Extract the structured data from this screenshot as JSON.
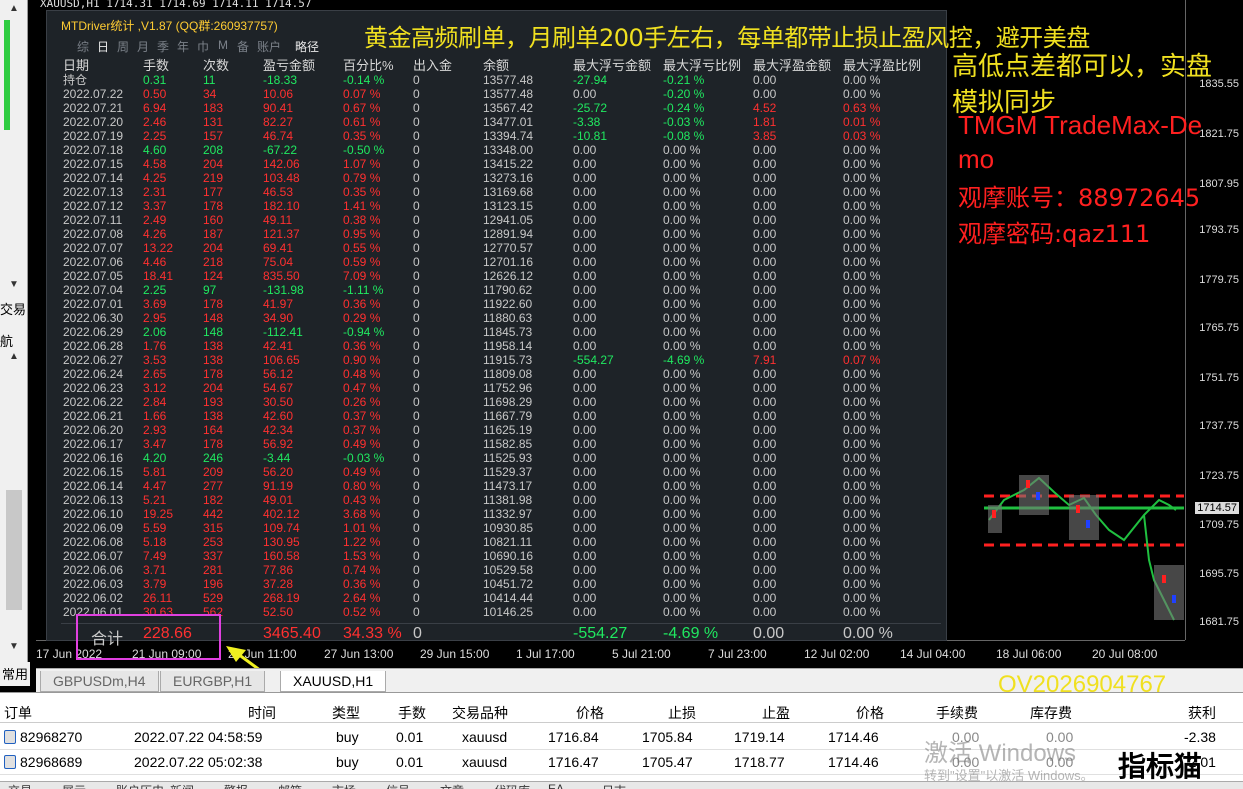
{
  "chart_header": "XAUUSD,H1  1714.31 1714.69 1714.11 1714.57",
  "panel": {
    "title": "MTDriver统计 ,V1.87 (QQ群:260937757)",
    "tabs": [
      "综",
      "日",
      "周",
      "月",
      "季",
      "年",
      "巾",
      "M",
      "备",
      "账户",
      "略径"
    ],
    "active_tab": "日",
    "headers": [
      "日期",
      "手数",
      "次数",
      "盈亏金额",
      "百分比%",
      "出入金",
      "余额",
      "最大浮亏金额",
      "最大浮亏比例",
      "最大浮盈金额",
      "最大浮盈比例"
    ],
    "rows": [
      [
        "持仓",
        "0.31",
        "11",
        "-18.33",
        "-0.14 %",
        "0",
        "13577.48",
        "-27.94",
        "-0.21 %",
        "0.00",
        "0.00 %"
      ],
      [
        "2022.07.22",
        "0.50",
        "34",
        "10.06",
        "0.07 %",
        "0",
        "13577.48",
        "0.00",
        "-0.20 %",
        "0.00",
        "0.00 %"
      ],
      [
        "2022.07.21",
        "6.94",
        "183",
        "90.41",
        "0.67 %",
        "0",
        "13567.42",
        "-25.72",
        "-0.24 %",
        "4.52",
        "0.63 %"
      ],
      [
        "2022.07.20",
        "2.46",
        "131",
        "82.27",
        "0.61 %",
        "0",
        "13477.01",
        "-3.38",
        "-0.03 %",
        "1.81",
        "0.01 %"
      ],
      [
        "2022.07.19",
        "2.25",
        "157",
        "46.74",
        "0.35 %",
        "0",
        "13394.74",
        "-10.81",
        "-0.08 %",
        "3.85",
        "0.03 %"
      ],
      [
        "2022.07.18",
        "4.60",
        "208",
        "-67.22",
        "-0.50 %",
        "0",
        "13348.00",
        "0.00",
        "0.00 %",
        "0.00",
        "0.00 %"
      ],
      [
        "2022.07.15",
        "4.58",
        "204",
        "142.06",
        "1.07 %",
        "0",
        "13415.22",
        "0.00",
        "0.00 %",
        "0.00",
        "0.00 %"
      ],
      [
        "2022.07.14",
        "4.25",
        "219",
        "103.48",
        "0.79 %",
        "0",
        "13273.16",
        "0.00",
        "0.00 %",
        "0.00",
        "0.00 %"
      ],
      [
        "2022.07.13",
        "2.31",
        "177",
        "46.53",
        "0.35 %",
        "0",
        "13169.68",
        "0.00",
        "0.00 %",
        "0.00",
        "0.00 %"
      ],
      [
        "2022.07.12",
        "3.37",
        "178",
        "182.10",
        "1.41 %",
        "0",
        "13123.15",
        "0.00",
        "0.00 %",
        "0.00",
        "0.00 %"
      ],
      [
        "2022.07.11",
        "2.49",
        "160",
        "49.11",
        "0.38 %",
        "0",
        "12941.05",
        "0.00",
        "0.00 %",
        "0.00",
        "0.00 %"
      ],
      [
        "2022.07.08",
        "4.26",
        "187",
        "121.37",
        "0.95 %",
        "0",
        "12891.94",
        "0.00",
        "0.00 %",
        "0.00",
        "0.00 %"
      ],
      [
        "2022.07.07",
        "13.22",
        "204",
        "69.41",
        "0.55 %",
        "0",
        "12770.57",
        "0.00",
        "0.00 %",
        "0.00",
        "0.00 %"
      ],
      [
        "2022.07.06",
        "4.46",
        "218",
        "75.04",
        "0.59 %",
        "0",
        "12701.16",
        "0.00",
        "0.00 %",
        "0.00",
        "0.00 %"
      ],
      [
        "2022.07.05",
        "18.41",
        "124",
        "835.50",
        "7.09 %",
        "0",
        "12626.12",
        "0.00",
        "0.00 %",
        "0.00",
        "0.00 %"
      ],
      [
        "2022.07.04",
        "2.25",
        "97",
        "-131.98",
        "-1.11 %",
        "0",
        "11790.62",
        "0.00",
        "0.00 %",
        "0.00",
        "0.00 %"
      ],
      [
        "2022.07.01",
        "3.69",
        "178",
        "41.97",
        "0.36 %",
        "0",
        "11922.60",
        "0.00",
        "0.00 %",
        "0.00",
        "0.00 %"
      ],
      [
        "2022.06.30",
        "2.95",
        "148",
        "34.90",
        "0.29 %",
        "0",
        "11880.63",
        "0.00",
        "0.00 %",
        "0.00",
        "0.00 %"
      ],
      [
        "2022.06.29",
        "2.06",
        "148",
        "-112.41",
        "-0.94 %",
        "0",
        "11845.73",
        "0.00",
        "0.00 %",
        "0.00",
        "0.00 %"
      ],
      [
        "2022.06.28",
        "1.76",
        "138",
        "42.41",
        "0.36 %",
        "0",
        "11958.14",
        "0.00",
        "0.00 %",
        "0.00",
        "0.00 %"
      ],
      [
        "2022.06.27",
        "3.53",
        "138",
        "106.65",
        "0.90 %",
        "0",
        "11915.73",
        "-554.27",
        "-4.69 %",
        "7.91",
        "0.07 %"
      ],
      [
        "2022.06.24",
        "2.65",
        "178",
        "56.12",
        "0.48 %",
        "0",
        "11809.08",
        "0.00",
        "0.00 %",
        "0.00",
        "0.00 %"
      ],
      [
        "2022.06.23",
        "3.12",
        "204",
        "54.67",
        "0.47 %",
        "0",
        "11752.96",
        "0.00",
        "0.00 %",
        "0.00",
        "0.00 %"
      ],
      [
        "2022.06.22",
        "2.84",
        "193",
        "30.50",
        "0.26 %",
        "0",
        "11698.29",
        "0.00",
        "0.00 %",
        "0.00",
        "0.00 %"
      ],
      [
        "2022.06.21",
        "1.66",
        "138",
        "42.60",
        "0.37 %",
        "0",
        "11667.79",
        "0.00",
        "0.00 %",
        "0.00",
        "0.00 %"
      ],
      [
        "2022.06.20",
        "2.93",
        "164",
        "42.34",
        "0.37 %",
        "0",
        "11625.19",
        "0.00",
        "0.00 %",
        "0.00",
        "0.00 %"
      ],
      [
        "2022.06.17",
        "3.47",
        "178",
        "56.92",
        "0.49 %",
        "0",
        "11582.85",
        "0.00",
        "0.00 %",
        "0.00",
        "0.00 %"
      ],
      [
        "2022.06.16",
        "4.20",
        "246",
        "-3.44",
        "-0.03 %",
        "0",
        "11525.93",
        "0.00",
        "0.00 %",
        "0.00",
        "0.00 %"
      ],
      [
        "2022.06.15",
        "5.81",
        "209",
        "56.20",
        "0.49 %",
        "0",
        "11529.37",
        "0.00",
        "0.00 %",
        "0.00",
        "0.00 %"
      ],
      [
        "2022.06.14",
        "4.47",
        "277",
        "91.19",
        "0.80 %",
        "0",
        "11473.17",
        "0.00",
        "0.00 %",
        "0.00",
        "0.00 %"
      ],
      [
        "2022.06.13",
        "5.21",
        "182",
        "49.01",
        "0.43 %",
        "0",
        "11381.98",
        "0.00",
        "0.00 %",
        "0.00",
        "0.00 %"
      ],
      [
        "2022.06.10",
        "19.25",
        "442",
        "402.12",
        "3.68 %",
        "0",
        "11332.97",
        "0.00",
        "0.00 %",
        "0.00",
        "0.00 %"
      ],
      [
        "2022.06.09",
        "5.59",
        "315",
        "109.74",
        "1.01 %",
        "0",
        "10930.85",
        "0.00",
        "0.00 %",
        "0.00",
        "0.00 %"
      ],
      [
        "2022.06.08",
        "5.18",
        "253",
        "130.95",
        "1.22 %",
        "0",
        "10821.11",
        "0.00",
        "0.00 %",
        "0.00",
        "0.00 %"
      ],
      [
        "2022.06.07",
        "7.49",
        "337",
        "160.58",
        "1.53 %",
        "0",
        "10690.16",
        "0.00",
        "0.00 %",
        "0.00",
        "0.00 %"
      ],
      [
        "2022.06.06",
        "3.71",
        "281",
        "77.86",
        "0.74 %",
        "0",
        "10529.58",
        "0.00",
        "0.00 %",
        "0.00",
        "0.00 %"
      ],
      [
        "2022.06.03",
        "3.79",
        "196",
        "37.28",
        "0.36 %",
        "0",
        "10451.72",
        "0.00",
        "0.00 %",
        "0.00",
        "0.00 %"
      ],
      [
        "2022.06.02",
        "26.11",
        "529",
        "268.19",
        "2.64 %",
        "0",
        "10414.44",
        "0.00",
        "0.00 %",
        "0.00",
        "0.00 %"
      ],
      [
        "2022.06.01",
        "30.63",
        "562",
        "52.50",
        "0.52 %",
        "0",
        "10146.25",
        "0.00",
        "0.00 %",
        "0.00",
        "0.00 %"
      ]
    ],
    "total": [
      "合计",
      "228.66",
      "",
      "3465.40",
      "34.33 %",
      "0",
      "",
      "-554.27",
      "-4.69 %",
      "0.00",
      "0.00 %"
    ]
  },
  "overlay": {
    "headline": "黄金高频刷单，月刷单200手左右，每单都带止损止盈风控，避开美盘",
    "line2": "高低点差都可以，实盘",
    "line3": "模拟同步",
    "broker1": "TMGM TradeMax-De",
    "broker2": "mo",
    "account": "观摩账号：88972645",
    "password": "观摩密码:qaz111",
    "qq": "QV2026904767",
    "watermark1": "激活 Windows",
    "watermark2": "转到\"设置\"以激活 Windows。",
    "logo": "指标猫"
  },
  "price_axis": [
    "1835.55",
    "1821.75",
    "1807.95",
    "1793.75",
    "1779.75",
    "1765.75",
    "1751.75",
    "1737.75",
    "1723.75",
    "1709.75",
    "1695.75",
    "1681.75"
  ],
  "current_price": "1714.57",
  "time_axis": [
    "17 Jun 2022",
    "21 Jun 09:00",
    "23 Jun 11:00",
    "27 Jun 13:00",
    "29 Jun 15:00",
    "1 Jul 17:00",
    "5 Jul 21:00",
    "7 Jul 23:00",
    "12 Jul 02:00",
    "14 Jul 04:00",
    "18 Jul 06:00",
    "20 Jul 08:00"
  ],
  "symbol_tabs": [
    "GBPUSDm,H4",
    "EURGBP,H1",
    "XAUUSD,H1"
  ],
  "active_symbol_tab": "XAUUSD,H1",
  "left_labels": {
    "trade": "交易",
    "nav": "航",
    "common": "常用"
  },
  "orders": {
    "headers": [
      "订单",
      "时间",
      "类型",
      "手数",
      "交易品种",
      "价格",
      "止损",
      "止盈",
      "价格",
      "手续费",
      "库存费",
      "获利"
    ],
    "rows": [
      [
        "82968270",
        "2022.07.22 04:58:59",
        "buy",
        "0.01",
        "xauusd",
        "1716.84",
        "1705.84",
        "1719.14",
        "1714.46",
        "0.00",
        "0.00",
        "-2.38"
      ],
      [
        "82968689",
        "2022.07.22 05:02:38",
        "buy",
        "0.01",
        "xauusd",
        "1716.47",
        "1705.47",
        "1718.77",
        "1714.46",
        "0.00",
        "0.00",
        "-2.01"
      ]
    ]
  },
  "bottom_tabs": [
    "交易",
    "展示",
    "账户历史",
    "新闻",
    "警报",
    "邮箱",
    "市场",
    "信号",
    "文章",
    "代码库",
    "EA",
    "日志"
  ],
  "colors": {
    "profit": "#20e860",
    "loss": "#ff3030",
    "highlight_pink": "#e040e0",
    "highlight_yellow": "#f0f020",
    "overlay_yellow": "#f0e020",
    "overlay_red": "#ff2020"
  }
}
